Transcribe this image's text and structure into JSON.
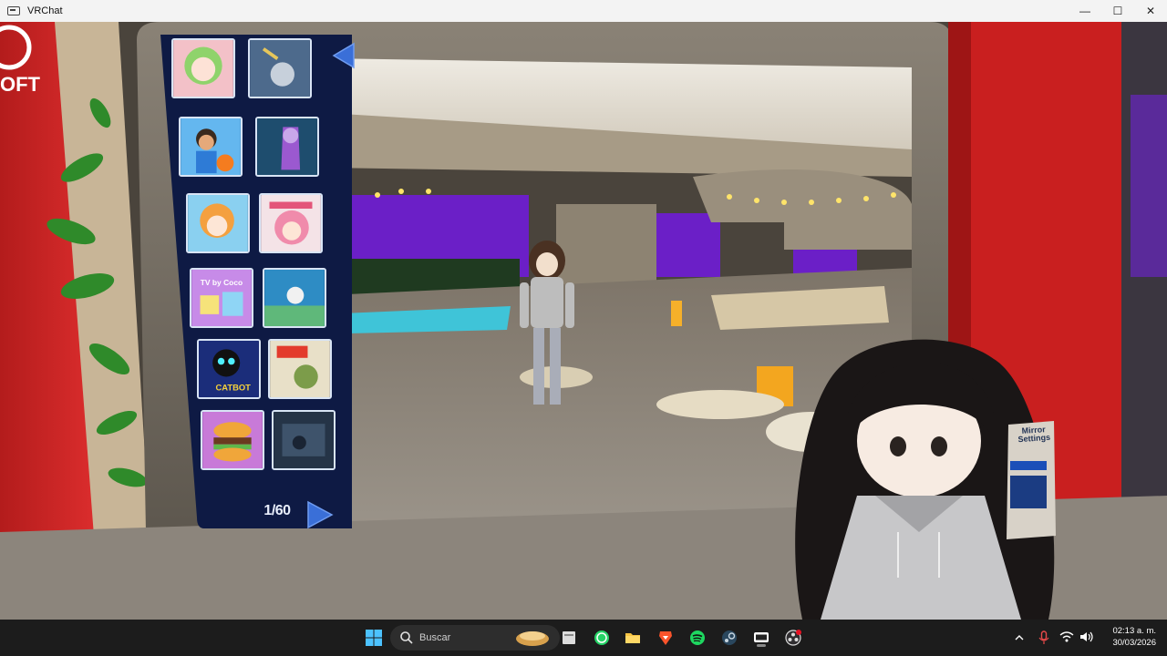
{
  "window": {
    "title": "VRChat",
    "minimize_glyph": "—",
    "maximize_glyph": "☐",
    "close_glyph": "✕"
  },
  "world_panel": {
    "page_counter": "1/60",
    "prev_icon": "triangle-left-icon",
    "next_icon": "triangle-right-icon",
    "thumbnails": [
      {
        "name": "world-thumb-1",
        "text": ""
      },
      {
        "name": "world-thumb-2",
        "text": ""
      },
      {
        "name": "world-thumb-3",
        "text": ""
      },
      {
        "name": "world-thumb-4",
        "text": ""
      },
      {
        "name": "world-thumb-5",
        "text": ""
      },
      {
        "name": "world-thumb-6",
        "text": ""
      },
      {
        "name": "world-thumb-7",
        "text": "TV by Coco"
      },
      {
        "name": "world-thumb-8",
        "text": ""
      },
      {
        "name": "world-thumb-9",
        "text": "CATBOT"
      },
      {
        "name": "world-thumb-10",
        "text": ""
      },
      {
        "name": "world-thumb-11",
        "text": ""
      },
      {
        "name": "world-thumb-12",
        "text": ""
      }
    ]
  },
  "scene": {
    "sign_left_text": "OFT",
    "mirror_sign_text": "Mirror Settings"
  },
  "taskbar": {
    "search_placeholder": "Buscar",
    "clock_time": "02:13 a. m.",
    "clock_date": "30/03/2026",
    "apps": [
      "windows-start-icon",
      "file-manager-icon",
      "whatsapp-icon",
      "folder-icon",
      "brave-icon",
      "spotify-icon",
      "steam-icon",
      "vrchat-icon",
      "obs-icon"
    ]
  },
  "colors": {
    "panel_bg": "#0e1a44",
    "arrow_blue": "#3a6fd8",
    "accent_red": "#d42424",
    "purple_wall": "#6b1fc7"
  }
}
